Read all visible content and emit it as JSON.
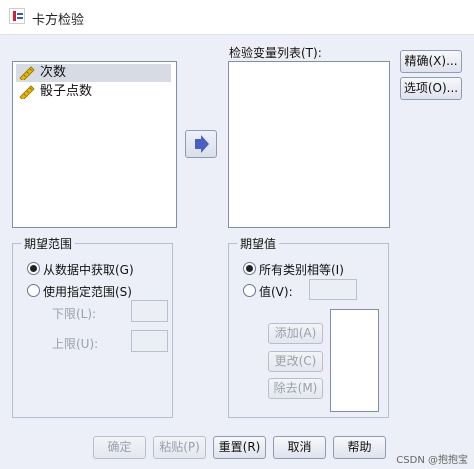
{
  "window": {
    "title": "卡方检验"
  },
  "source_list": {
    "items": [
      {
        "label": "次数",
        "icon": "scale-ruler-icon",
        "selected": true
      },
      {
        "label": "骰子点数",
        "icon": "scale-ruler-icon",
        "selected": false
      }
    ]
  },
  "test_variable_list": {
    "label": "检验变量列表(T):"
  },
  "side_buttons": {
    "exact": "精确(X)...",
    "options": "选项(O)..."
  },
  "move_button": {
    "icon": "right-arrow-icon"
  },
  "expected_range": {
    "title": "期望范围",
    "from_data": "从数据中获取(G)",
    "use_specified": "使用指定范围(S)",
    "lower": "下限(L):",
    "upper": "上限(U):",
    "selected": "from_data"
  },
  "expected_values": {
    "title": "期望值",
    "all_equal": "所有类别相等(I)",
    "values": "值(V):",
    "add": "添加(A)",
    "change": "更改(C)",
    "remove": "除去(M)",
    "selected": "all_equal"
  },
  "bottom_buttons": {
    "ok": "确定",
    "paste": "粘贴(P)",
    "reset": "重置(R)",
    "cancel": "取消",
    "help": "帮助"
  },
  "watermark": "CSDN @抱抱宝",
  "colors": {
    "arrow": "#4a5fc1",
    "ruler": "#d9a400"
  }
}
